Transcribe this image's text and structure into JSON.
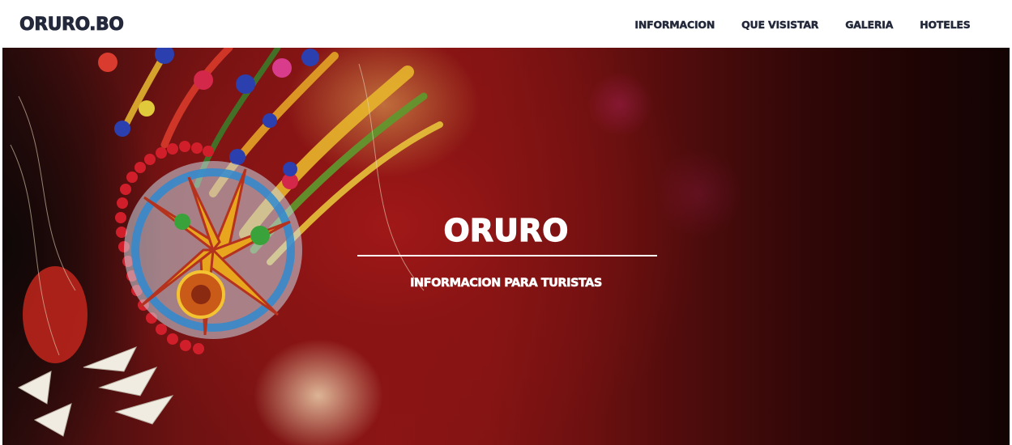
{
  "header": {
    "brand": "ORURO.BO",
    "nav": [
      {
        "label": "INFORMACION"
      },
      {
        "label": "QUE VISISTAR"
      },
      {
        "label": "GALERIA"
      },
      {
        "label": "HOTELES"
      }
    ]
  },
  "hero": {
    "title": "ORURO",
    "subtitle": "INFORMACION PARA TURISTAS",
    "background_image": "carnival-mask-photo"
  },
  "colors": {
    "text_dark": "#23283a",
    "hero_red": "#8c1515",
    "white": "#ffffff"
  }
}
